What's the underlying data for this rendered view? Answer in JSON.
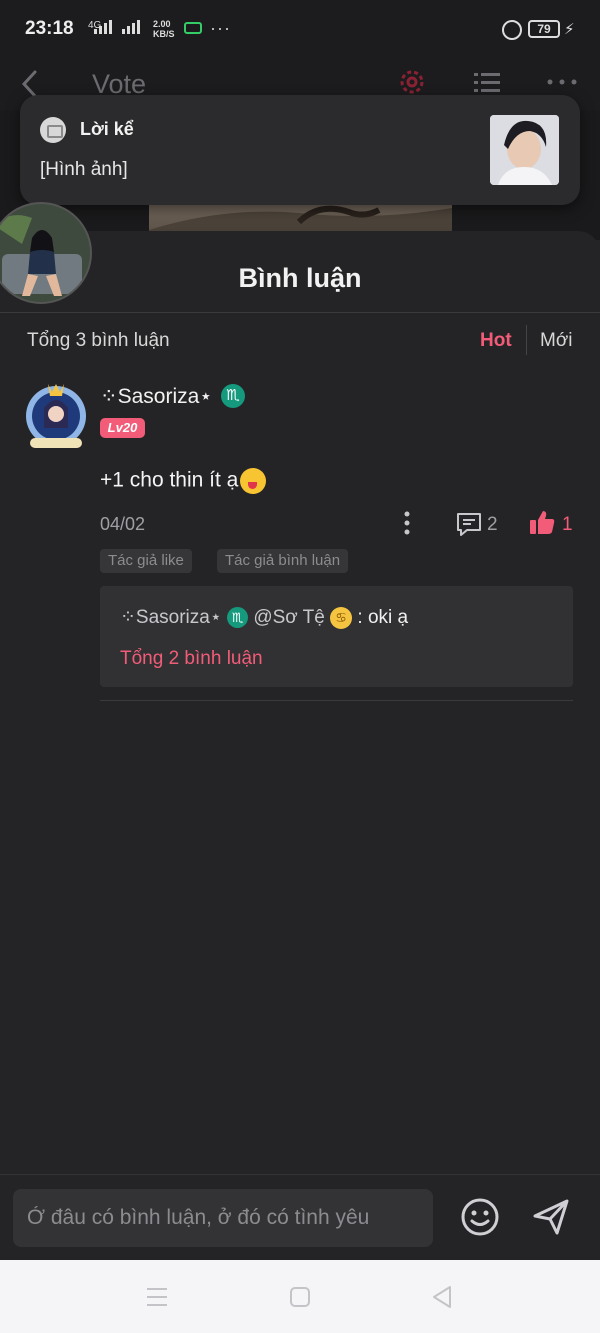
{
  "status_bar": {
    "time": "23:18",
    "network": "4G",
    "speed_value": "2.00",
    "speed_unit": "KB/S",
    "more": "···",
    "battery": "79"
  },
  "header": {
    "title": "Vote",
    "accent_color": "#e0334f"
  },
  "notification": {
    "app_name": "Lời kể",
    "message": "[Hình ảnh]"
  },
  "comments": {
    "title": "Bình luận",
    "total_label": "Tổng 3 bình luận",
    "sort_options": [
      "Hot",
      "Mới"
    ],
    "active_sort": "Hot",
    "items": [
      {
        "username": "⁘Sasoriza⋆",
        "zodiac_sign": "♏",
        "level": "Lv20",
        "text": "+1 cho thin ít ạ",
        "emoji": "yum-emoji-icon",
        "date": "04/02",
        "reply_count": "2",
        "like_count": "1",
        "tags": [
          "Tác giả like",
          "Tác giả bình luận"
        ],
        "reply_preview": {
          "username": "⁘Sasoriza⋆",
          "zodiac_sign": "♏",
          "mention": "@Sơ Tệ",
          "mention_sign": "♋",
          "text": ": oki ạ",
          "total_label": "Tổng 2 bình luận"
        }
      }
    ]
  },
  "input": {
    "placeholder": "Ở đâu có bình luận, ở đó có tình yêu"
  },
  "colors": {
    "accent": "#f25c78",
    "background": "#242426",
    "zodiac_badge": "#159a7e"
  }
}
